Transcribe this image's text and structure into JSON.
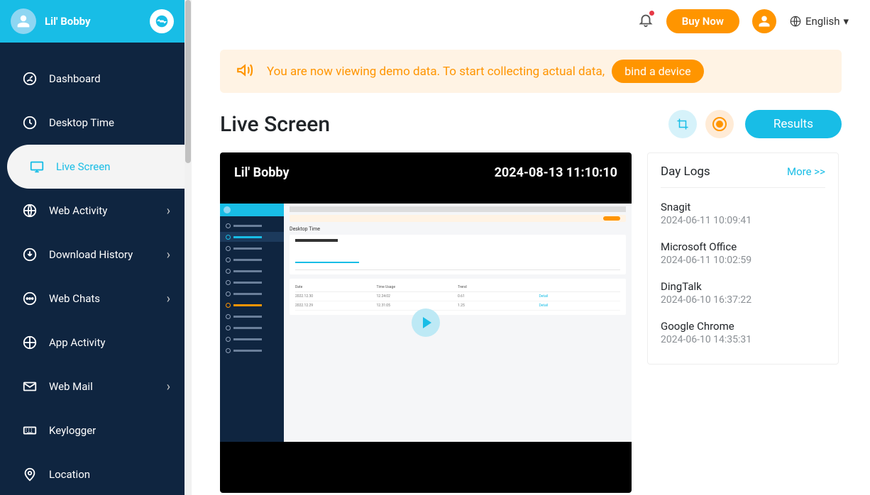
{
  "profile": {
    "name": "Lil' Bobby"
  },
  "sidebar": {
    "items": [
      {
        "label": "Dashboard",
        "icon": "gauge",
        "chevron": false
      },
      {
        "label": "Desktop Time",
        "icon": "clock",
        "chevron": false
      },
      {
        "label": "Live Screen",
        "icon": "monitor",
        "chevron": false,
        "active": true
      },
      {
        "label": "Web Activity",
        "icon": "globe",
        "chevron": true
      },
      {
        "label": "Download History",
        "icon": "download",
        "chevron": true
      },
      {
        "label": "Web Chats",
        "icon": "chat",
        "chevron": true
      },
      {
        "label": "App Activity",
        "icon": "app",
        "chevron": false
      },
      {
        "label": "Web Mail",
        "icon": "mail",
        "chevron": true
      },
      {
        "label": "Keylogger",
        "icon": "keyboard",
        "chevron": false
      },
      {
        "label": "Location",
        "icon": "pin",
        "chevron": false
      }
    ]
  },
  "topbar": {
    "buy_label": "Buy Now",
    "language": "English"
  },
  "banner": {
    "text": "You are now viewing demo data. To start collecting actual data, ",
    "cta": "bind a device"
  },
  "page": {
    "title": "Live Screen",
    "results_label": "Results"
  },
  "video": {
    "name": "Lil' Bobby",
    "timestamp": "2024-08-13 11:10:10",
    "mini_title": "Desktop Time",
    "table": {
      "headers": [
        "Date",
        "Time Usage",
        "Trend",
        ""
      ],
      "rows": [
        [
          "2022.12.30",
          "12.24:02",
          "0.61",
          "Detail"
        ],
        [
          "2022.12.29",
          "12.31:05",
          "1.25",
          "Detail"
        ]
      ]
    }
  },
  "logs": {
    "title": "Day Logs",
    "more": "More >>",
    "items": [
      {
        "app": "Snagit",
        "ts": "2024-06-11 10:09:41"
      },
      {
        "app": "Microsoft Office",
        "ts": "2024-06-11 10:02:59"
      },
      {
        "app": "DingTalk",
        "ts": "2024-06-10 16:37:22"
      },
      {
        "app": "Google Chrome",
        "ts": "2024-06-10 14:35:31"
      }
    ]
  }
}
